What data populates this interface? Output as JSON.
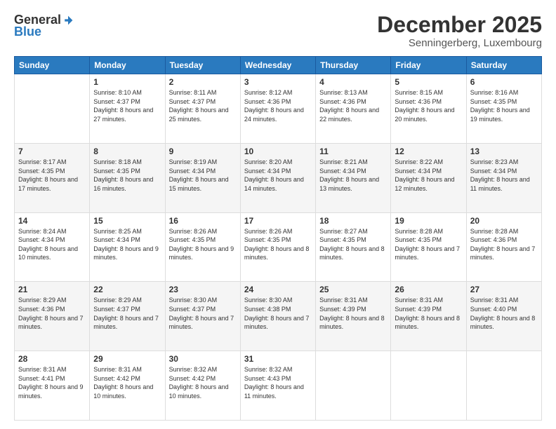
{
  "logo": {
    "general": "General",
    "blue": "Blue"
  },
  "header": {
    "title": "December 2025",
    "location": "Senningerberg, Luxembourg"
  },
  "days_of_week": [
    "Sunday",
    "Monday",
    "Tuesday",
    "Wednesday",
    "Thursday",
    "Friday",
    "Saturday"
  ],
  "weeks": [
    [
      {
        "day": "",
        "sunrise": "",
        "sunset": "",
        "daylight": ""
      },
      {
        "day": "1",
        "sunrise": "Sunrise: 8:10 AM",
        "sunset": "Sunset: 4:37 PM",
        "daylight": "Daylight: 8 hours and 27 minutes."
      },
      {
        "day": "2",
        "sunrise": "Sunrise: 8:11 AM",
        "sunset": "Sunset: 4:37 PM",
        "daylight": "Daylight: 8 hours and 25 minutes."
      },
      {
        "day": "3",
        "sunrise": "Sunrise: 8:12 AM",
        "sunset": "Sunset: 4:36 PM",
        "daylight": "Daylight: 8 hours and 24 minutes."
      },
      {
        "day": "4",
        "sunrise": "Sunrise: 8:13 AM",
        "sunset": "Sunset: 4:36 PM",
        "daylight": "Daylight: 8 hours and 22 minutes."
      },
      {
        "day": "5",
        "sunrise": "Sunrise: 8:15 AM",
        "sunset": "Sunset: 4:36 PM",
        "daylight": "Daylight: 8 hours and 20 minutes."
      },
      {
        "day": "6",
        "sunrise": "Sunrise: 8:16 AM",
        "sunset": "Sunset: 4:35 PM",
        "daylight": "Daylight: 8 hours and 19 minutes."
      }
    ],
    [
      {
        "day": "7",
        "sunrise": "Sunrise: 8:17 AM",
        "sunset": "Sunset: 4:35 PM",
        "daylight": "Daylight: 8 hours and 17 minutes."
      },
      {
        "day": "8",
        "sunrise": "Sunrise: 8:18 AM",
        "sunset": "Sunset: 4:35 PM",
        "daylight": "Daylight: 8 hours and 16 minutes."
      },
      {
        "day": "9",
        "sunrise": "Sunrise: 8:19 AM",
        "sunset": "Sunset: 4:34 PM",
        "daylight": "Daylight: 8 hours and 15 minutes."
      },
      {
        "day": "10",
        "sunrise": "Sunrise: 8:20 AM",
        "sunset": "Sunset: 4:34 PM",
        "daylight": "Daylight: 8 hours and 14 minutes."
      },
      {
        "day": "11",
        "sunrise": "Sunrise: 8:21 AM",
        "sunset": "Sunset: 4:34 PM",
        "daylight": "Daylight: 8 hours and 13 minutes."
      },
      {
        "day": "12",
        "sunrise": "Sunrise: 8:22 AM",
        "sunset": "Sunset: 4:34 PM",
        "daylight": "Daylight: 8 hours and 12 minutes."
      },
      {
        "day": "13",
        "sunrise": "Sunrise: 8:23 AM",
        "sunset": "Sunset: 4:34 PM",
        "daylight": "Daylight: 8 hours and 11 minutes."
      }
    ],
    [
      {
        "day": "14",
        "sunrise": "Sunrise: 8:24 AM",
        "sunset": "Sunset: 4:34 PM",
        "daylight": "Daylight: 8 hours and 10 minutes."
      },
      {
        "day": "15",
        "sunrise": "Sunrise: 8:25 AM",
        "sunset": "Sunset: 4:34 PM",
        "daylight": "Daylight: 8 hours and 9 minutes."
      },
      {
        "day": "16",
        "sunrise": "Sunrise: 8:26 AM",
        "sunset": "Sunset: 4:35 PM",
        "daylight": "Daylight: 8 hours and 9 minutes."
      },
      {
        "day": "17",
        "sunrise": "Sunrise: 8:26 AM",
        "sunset": "Sunset: 4:35 PM",
        "daylight": "Daylight: 8 hours and 8 minutes."
      },
      {
        "day": "18",
        "sunrise": "Sunrise: 8:27 AM",
        "sunset": "Sunset: 4:35 PM",
        "daylight": "Daylight: 8 hours and 8 minutes."
      },
      {
        "day": "19",
        "sunrise": "Sunrise: 8:28 AM",
        "sunset": "Sunset: 4:35 PM",
        "daylight": "Daylight: 8 hours and 7 minutes."
      },
      {
        "day": "20",
        "sunrise": "Sunrise: 8:28 AM",
        "sunset": "Sunset: 4:36 PM",
        "daylight": "Daylight: 8 hours and 7 minutes."
      }
    ],
    [
      {
        "day": "21",
        "sunrise": "Sunrise: 8:29 AM",
        "sunset": "Sunset: 4:36 PM",
        "daylight": "Daylight: 8 hours and 7 minutes."
      },
      {
        "day": "22",
        "sunrise": "Sunrise: 8:29 AM",
        "sunset": "Sunset: 4:37 PM",
        "daylight": "Daylight: 8 hours and 7 minutes."
      },
      {
        "day": "23",
        "sunrise": "Sunrise: 8:30 AM",
        "sunset": "Sunset: 4:37 PM",
        "daylight": "Daylight: 8 hours and 7 minutes."
      },
      {
        "day": "24",
        "sunrise": "Sunrise: 8:30 AM",
        "sunset": "Sunset: 4:38 PM",
        "daylight": "Daylight: 8 hours and 7 minutes."
      },
      {
        "day": "25",
        "sunrise": "Sunrise: 8:31 AM",
        "sunset": "Sunset: 4:39 PM",
        "daylight": "Daylight: 8 hours and 8 minutes."
      },
      {
        "day": "26",
        "sunrise": "Sunrise: 8:31 AM",
        "sunset": "Sunset: 4:39 PM",
        "daylight": "Daylight: 8 hours and 8 minutes."
      },
      {
        "day": "27",
        "sunrise": "Sunrise: 8:31 AM",
        "sunset": "Sunset: 4:40 PM",
        "daylight": "Daylight: 8 hours and 8 minutes."
      }
    ],
    [
      {
        "day": "28",
        "sunrise": "Sunrise: 8:31 AM",
        "sunset": "Sunset: 4:41 PM",
        "daylight": "Daylight: 8 hours and 9 minutes."
      },
      {
        "day": "29",
        "sunrise": "Sunrise: 8:31 AM",
        "sunset": "Sunset: 4:42 PM",
        "daylight": "Daylight: 8 hours and 10 minutes."
      },
      {
        "day": "30",
        "sunrise": "Sunrise: 8:32 AM",
        "sunset": "Sunset: 4:42 PM",
        "daylight": "Daylight: 8 hours and 10 minutes."
      },
      {
        "day": "31",
        "sunrise": "Sunrise: 8:32 AM",
        "sunset": "Sunset: 4:43 PM",
        "daylight": "Daylight: 8 hours and 11 minutes."
      },
      {
        "day": "",
        "sunrise": "",
        "sunset": "",
        "daylight": ""
      },
      {
        "day": "",
        "sunrise": "",
        "sunset": "",
        "daylight": ""
      },
      {
        "day": "",
        "sunrise": "",
        "sunset": "",
        "daylight": ""
      }
    ]
  ]
}
